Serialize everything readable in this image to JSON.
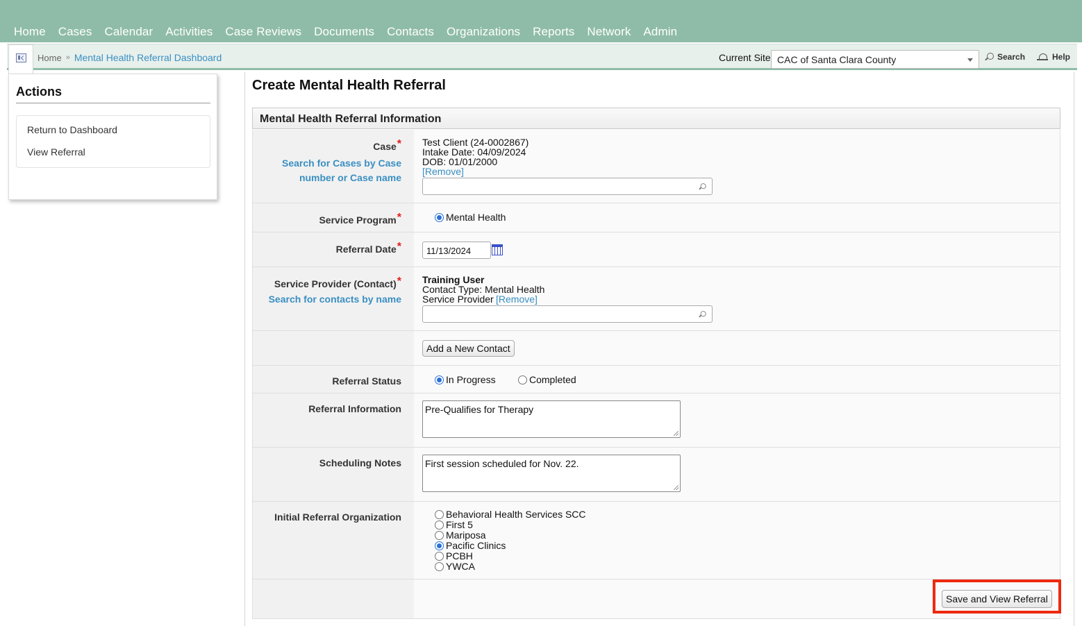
{
  "nav": {
    "items": [
      "Home",
      "Cases",
      "Calendar",
      "Activities",
      "Case Reviews",
      "Documents",
      "Contacts",
      "Organizations",
      "Reports",
      "Network",
      "Admin"
    ]
  },
  "breadcrumb": {
    "home": "Home",
    "separator": "»",
    "current": "Mental Health Referral Dashboard"
  },
  "site": {
    "label": "Current Site",
    "selected": "CAC of Santa Clara County"
  },
  "tools": {
    "search": "Search",
    "help": "Help"
  },
  "actions": {
    "title": "Actions",
    "links": [
      "Return to Dashboard",
      "View Referral"
    ]
  },
  "page": {
    "title": "Create Mental Health Referral",
    "section": "Mental Health Referral Information"
  },
  "form": {
    "case": {
      "label": "Case",
      "required": "*",
      "help": "Search for Cases by Case number or Case name",
      "client": "Test Client (24-0002867)",
      "intake": "Intake Date: 04/09/2024",
      "dob": "DOB: 01/01/2000",
      "remove": "[Remove]",
      "search_value": ""
    },
    "service_program": {
      "label": "Service Program",
      "required": "*",
      "option": "Mental Health"
    },
    "referral_date": {
      "label": "Referral Date",
      "required": "*",
      "value": "11/13/2024"
    },
    "service_provider": {
      "label": "Service Provider (Contact)",
      "required": "*",
      "help": "Search for contacts by name",
      "name": "Training User",
      "contact_type": "Contact Type: Mental Health",
      "contact_type_2": "Service Provider",
      "remove": "[Remove]",
      "search_value": ""
    },
    "add_contact_button": "Add a New Contact",
    "referral_status": {
      "label": "Referral Status",
      "options": [
        "In Progress",
        "Completed"
      ],
      "selected": "In Progress"
    },
    "referral_information": {
      "label": "Referral Information",
      "value": "Pre-Qualifies for Therapy"
    },
    "scheduling_notes": {
      "label": "Scheduling Notes",
      "value": "First session scheduled for Nov. 22."
    },
    "initial_referral_org": {
      "label": "Initial Referral Organization",
      "options": [
        "Behavioral Health Services SCC",
        "First 5",
        "Mariposa",
        "Pacific Clinics",
        "PCBH",
        "YWCA"
      ],
      "selected": "Pacific Clinics"
    },
    "save_button": "Save and View Referral"
  },
  "colors": {
    "nav_bg": "#8fbca8",
    "link": "#3a8fc2",
    "required": "#e02020",
    "highlight": "#ee2a0f"
  }
}
